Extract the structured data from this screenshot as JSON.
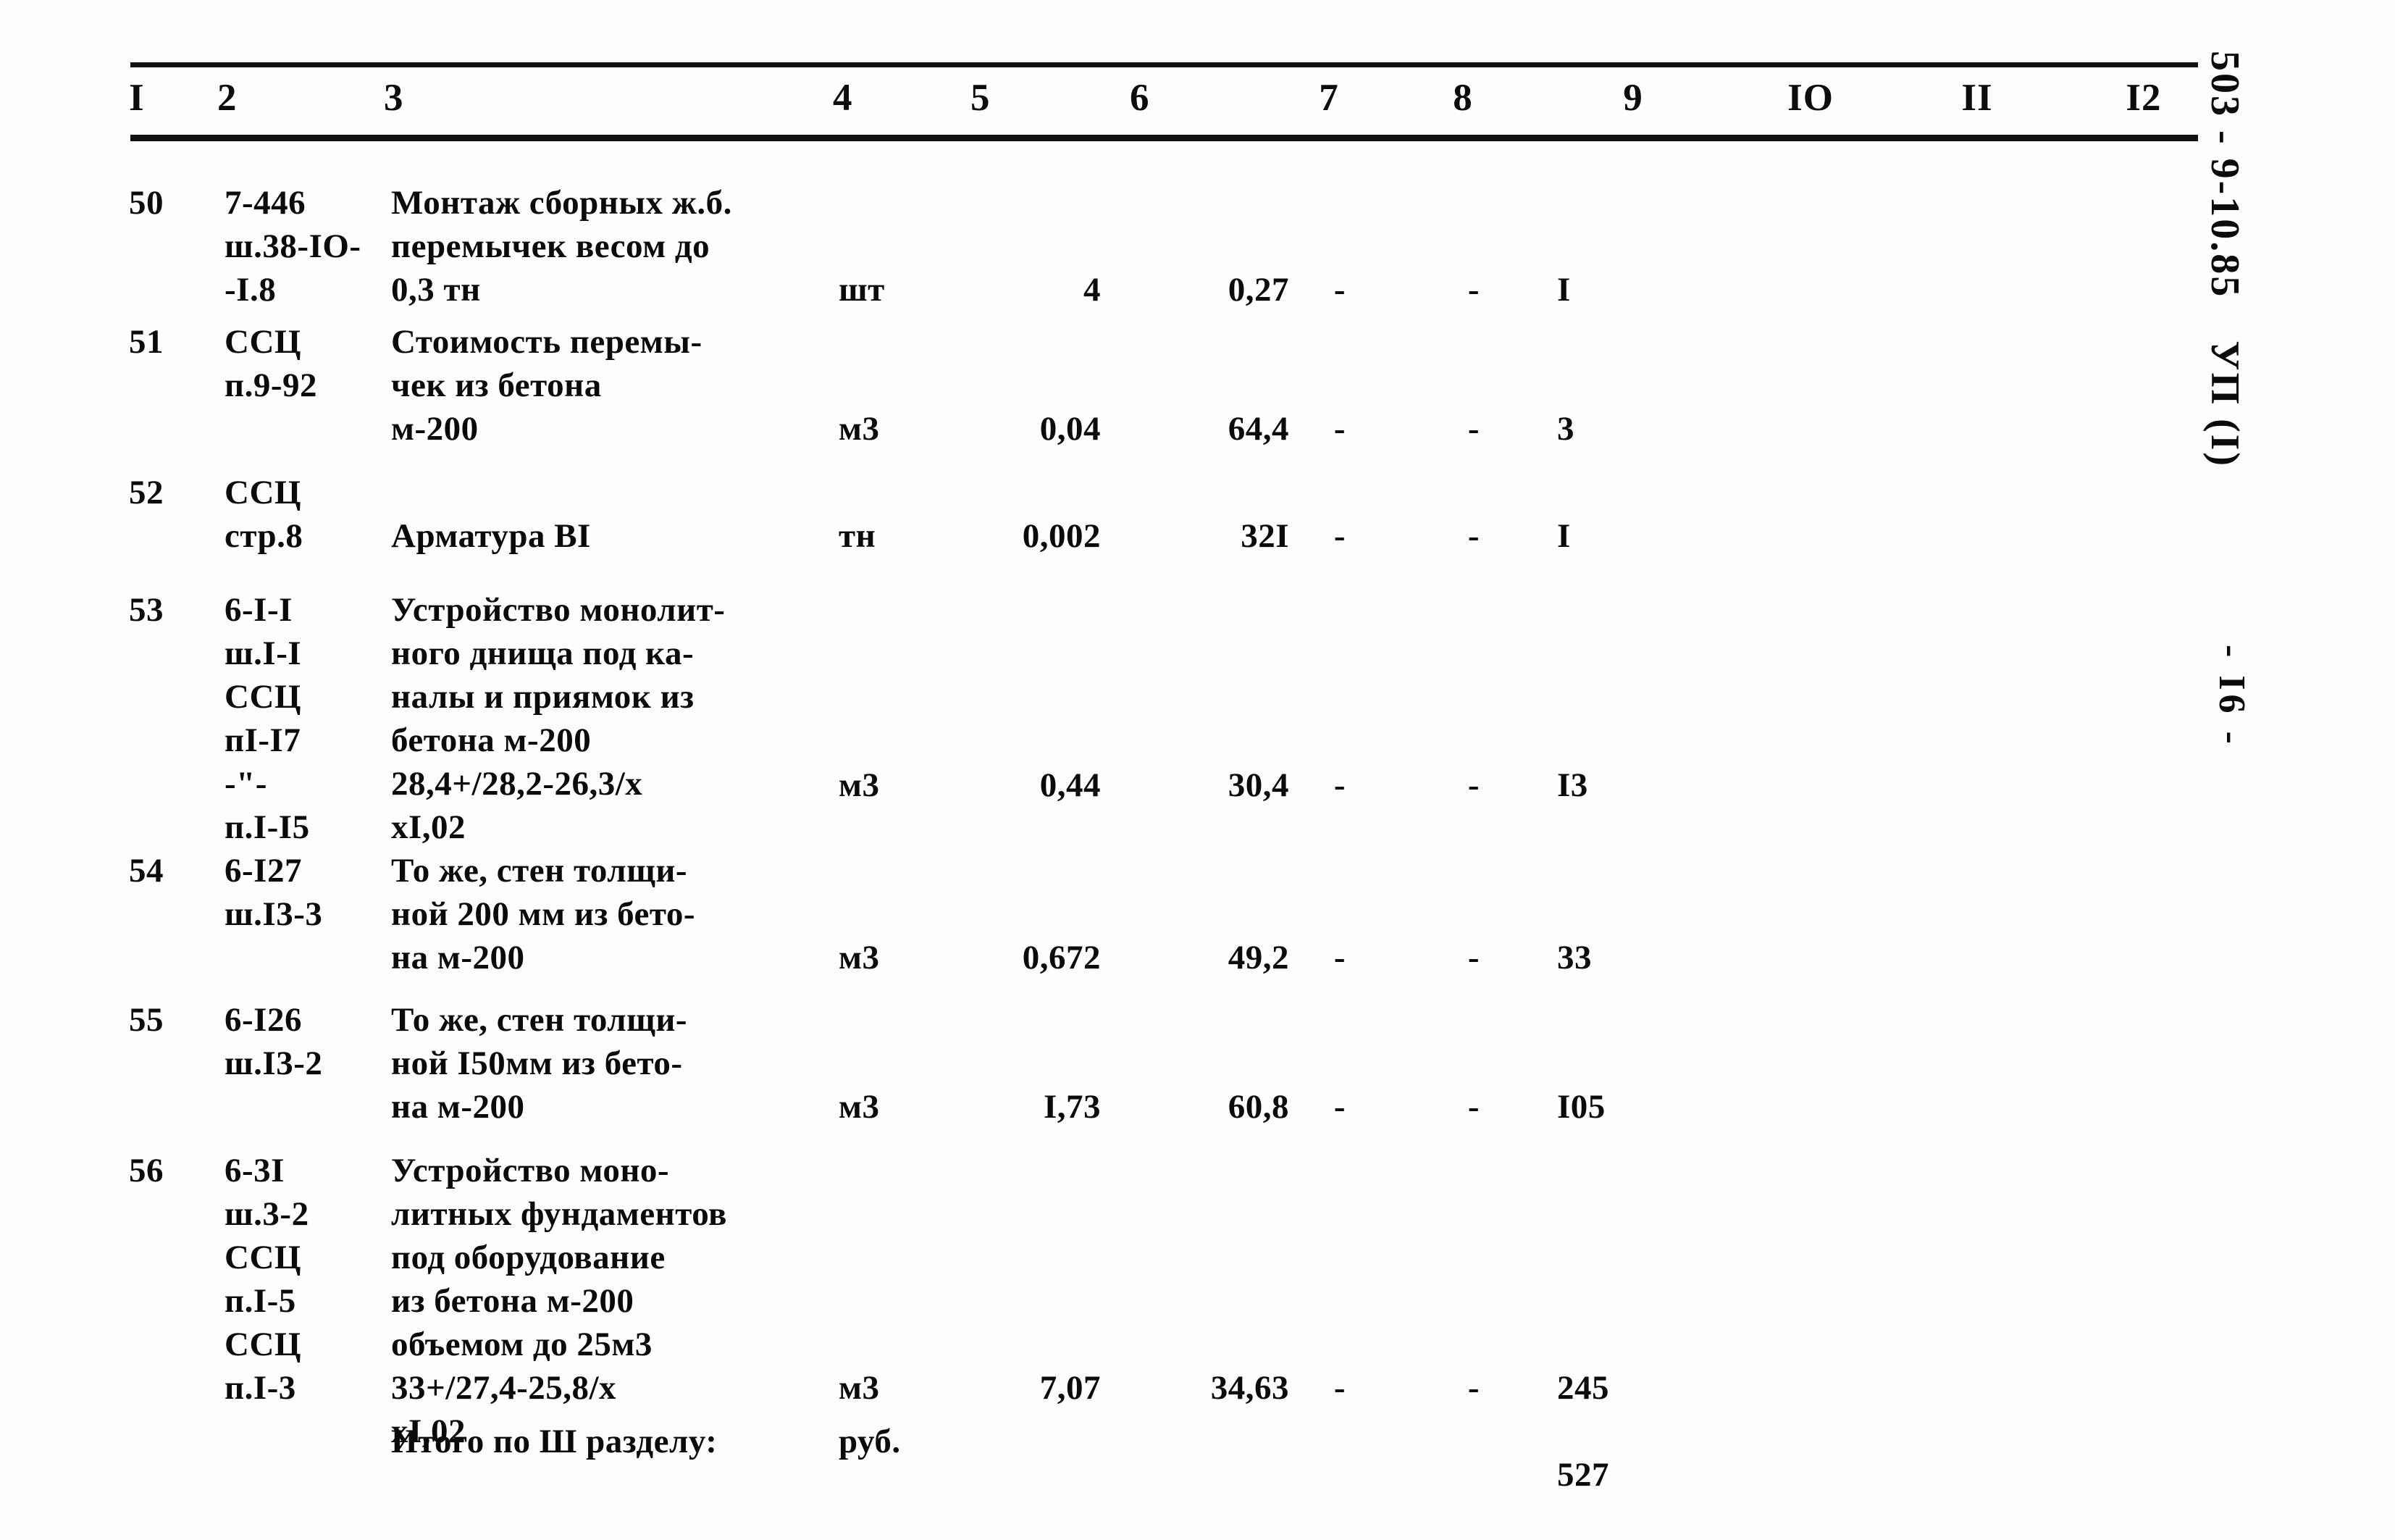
{
  "document": {
    "side_code": "503 - 9-10.85",
    "side_code_suffix": "УП (I)",
    "page_marker": "- I6 -"
  },
  "table": {
    "column_headers": [
      "I",
      "2",
      "3",
      "4",
      "5",
      "6",
      "7",
      "8",
      "9",
      "IO",
      "II",
      "I2"
    ],
    "rows": [
      {
        "num": "50",
        "code": "7-446\nш.38-IO-\n-I.8",
        "desc": "Монтаж сборных ж.б.\nперемычек весом до\n0,3 тн",
        "unit": "шт",
        "qty": "4",
        "price": "0,27",
        "c7": "-",
        "c8": "-",
        "c9": "I",
        "c10": "",
        "c11": "",
        "c12": ""
      },
      {
        "num": "51",
        "code": "ССЦ\nп.9-92",
        "desc": "Стоимость перемы-\nчек из бетона\nм-200",
        "unit": "м3",
        "qty": "0,04",
        "price": "64,4",
        "c7": "-",
        "c8": "-",
        "c9": "3",
        "c10": "",
        "c11": "",
        "c12": ""
      },
      {
        "num": "52",
        "code": "ССЦ\nстр.8",
        "desc": "Арматура ВI",
        "unit": "тн",
        "qty": "0,002",
        "price": "32I",
        "c7": "-",
        "c8": "-",
        "c9": "I",
        "c10": "",
        "c11": "",
        "c12": ""
      },
      {
        "num": "53",
        "code": "6-I-I\nш.I-I\nССЦ\nпI-I7\n-\"-\nп.I-I5",
        "desc": "Устройство монолит-\nного днища под ка-\nналы и приямок из\nбетона м-200\n28,4+/28,2-26,3/х\nхI,02",
        "unit": "м3",
        "qty": "0,44",
        "price": "30,4",
        "c7": "-",
        "c8": "-",
        "c9": "I3",
        "c10": "",
        "c11": "",
        "c12": ""
      },
      {
        "num": "54",
        "code": "6-I27\nш.I3-3",
        "desc": "То же, стен толщи-\nной 200 мм из бето-\nна м-200",
        "unit": "м3",
        "qty": "0,672",
        "price": "49,2",
        "c7": "-",
        "c8": "-",
        "c9": "33",
        "c10": "",
        "c11": "",
        "c12": ""
      },
      {
        "num": "55",
        "code": "6-I26\nш.I3-2",
        "desc": "То же, стен толщи-\nной I50мм из бето-\nна м-200",
        "unit": "м3",
        "qty": "I,73",
        "price": "60,8",
        "c7": "-",
        "c8": "-",
        "c9": "I05",
        "c10": "",
        "c11": "",
        "c12": ""
      },
      {
        "num": "56",
        "code": "6-3I\nш.3-2\nССЦ\nп.I-5\nССЦ\nп.I-3",
        "desc": "Устройство моно-\nлитных фундаментов\nпод оборудование\nиз бетона м-200\nобъемом до 25м3\n33+/27,4-25,8/х\nхI,02",
        "unit": "м3",
        "qty": "7,07",
        "price": "34,63",
        "c7": "-",
        "c8": "-",
        "c9": "245",
        "c10": "",
        "c11": "",
        "c12": ""
      }
    ],
    "total_row": {
      "label": "Итого по Ш разделу:",
      "unit": "руб.",
      "value": "527"
    }
  }
}
